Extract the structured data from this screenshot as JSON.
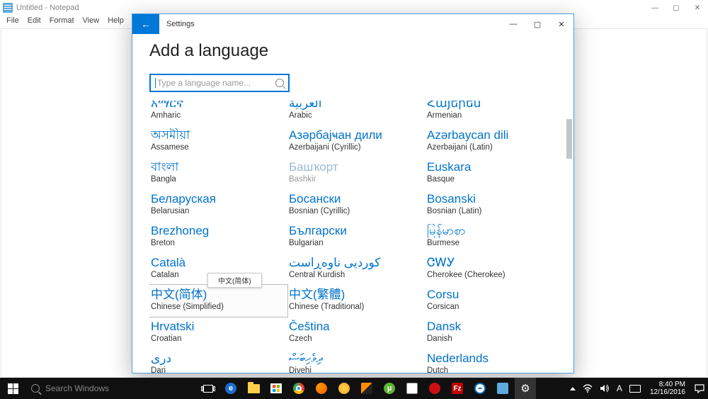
{
  "notepad": {
    "title": "Untitled - Notepad",
    "menu": [
      "File",
      "Edit",
      "Format",
      "View",
      "Help"
    ],
    "min": "—",
    "max": "▢",
    "close": "✕"
  },
  "settings": {
    "titlebar": "Settings",
    "back": "←",
    "min": "—",
    "max": "▢",
    "close": "✕",
    "heading": "Add a language",
    "search_placeholder": "Type a language name...",
    "tooltip": "中文(简体)",
    "languages": [
      {
        "native": "አማርኛ",
        "english": "Amharic",
        "cut": true
      },
      {
        "native": "العربية",
        "english": "Arabic",
        "cut": true
      },
      {
        "native": "Հայերեն",
        "english": "Armenian",
        "cut": true
      },
      {
        "native": "অসমীয়া",
        "english": "Assamese"
      },
      {
        "native": "Азәрбајҹан дили",
        "english": "Azerbaijani (Cyrillic)"
      },
      {
        "native": "Azərbaycan dili",
        "english": "Azerbaijani (Latin)"
      },
      {
        "native": "বাংলা",
        "english": "Bangla"
      },
      {
        "native": "Башҡорт",
        "english": "Bashkir",
        "disabled": true
      },
      {
        "native": "Euskara",
        "english": "Basque"
      },
      {
        "native": "Беларуская",
        "english": "Belarusian"
      },
      {
        "native": "Босански",
        "english": "Bosnian (Cyrillic)"
      },
      {
        "native": "Bosanski",
        "english": "Bosnian (Latin)"
      },
      {
        "native": "Brezhoneg",
        "english": "Breton"
      },
      {
        "native": "Български",
        "english": "Bulgarian"
      },
      {
        "native": "မြန်မာစာ",
        "english": "Burmese"
      },
      {
        "native": "Català",
        "english": "Catalan"
      },
      {
        "native": "کوردیی ناوەڕاست",
        "english": "Central Kurdish"
      },
      {
        "native": "ᏣᎳᎩ",
        "english": "Cherokee (Cherokee)"
      },
      {
        "native": "中文(简体)",
        "english": "Chinese (Simplified)",
        "hover": true,
        "tooltip": true
      },
      {
        "native": "中文(繁體)",
        "english": "Chinese (Traditional)"
      },
      {
        "native": "Corsu",
        "english": "Corsican"
      },
      {
        "native": "Hrvatski",
        "english": "Croatian"
      },
      {
        "native": "Čeština",
        "english": "Czech"
      },
      {
        "native": "Dansk",
        "english": "Danish"
      },
      {
        "native": "درى",
        "english": "Dari"
      },
      {
        "native": "ދިވެހިބަސް",
        "english": "Divehi"
      },
      {
        "native": "Nederlands",
        "english": "Dutch"
      }
    ]
  },
  "taskbar": {
    "search_placeholder": "Search Windows",
    "time": "8:40 PM",
    "date": "12/16/2016",
    "tray_letter": "A"
  }
}
